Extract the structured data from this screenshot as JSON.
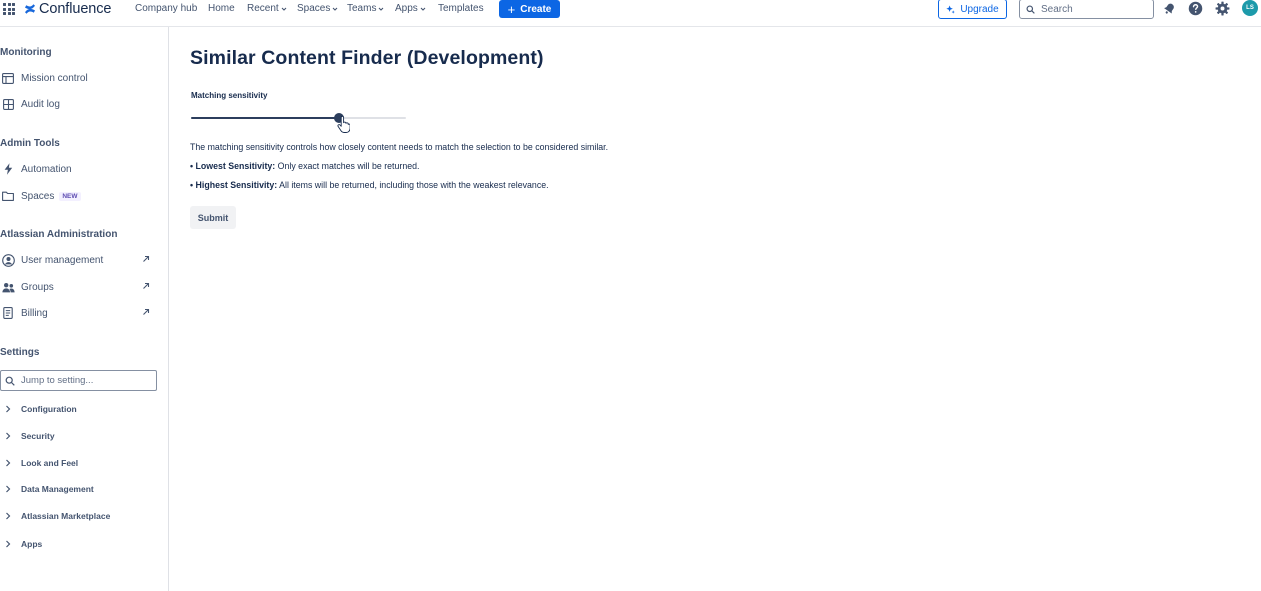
{
  "topbar": {
    "app_name": "Confluence",
    "nav": [
      {
        "label": "Company hub",
        "dropdown": false
      },
      {
        "label": "Home",
        "dropdown": false
      },
      {
        "label": "Recent",
        "dropdown": true
      },
      {
        "label": "Spaces",
        "dropdown": true
      },
      {
        "label": "Teams",
        "dropdown": true
      },
      {
        "label": "Apps",
        "dropdown": true
      },
      {
        "label": "Templates",
        "dropdown": false
      }
    ],
    "create_label": "Create",
    "upgrade_label": "Upgrade",
    "search_placeholder": "Search",
    "avatar_initials": "LS",
    "icons": [
      "app-switcher-icon",
      "confluence-logo-icon",
      "notifications-icon",
      "help-icon",
      "settings-icon"
    ]
  },
  "sidebar": {
    "sections": [
      {
        "heading": "Monitoring",
        "items": [
          {
            "label": "Mission control",
            "icon": "dashboard-icon"
          },
          {
            "label": "Audit log",
            "icon": "table-icon"
          }
        ]
      },
      {
        "heading": "Admin Tools",
        "items": [
          {
            "label": "Automation",
            "icon": "lightning-icon"
          },
          {
            "label": "Spaces",
            "icon": "folder-icon",
            "badge": "NEW"
          }
        ]
      },
      {
        "heading": "Atlassian Administration",
        "items": [
          {
            "label": "User management",
            "icon": "user-avatar-icon",
            "external": true
          },
          {
            "label": "Groups",
            "icon": "people-group-icon",
            "external": true
          },
          {
            "label": "Billing",
            "icon": "receipt-icon",
            "external": true
          }
        ]
      }
    ],
    "settings": {
      "heading": "Settings",
      "jump_placeholder": "Jump to setting...",
      "items": [
        "Configuration",
        "Security",
        "Look and Feel",
        "Data Management",
        "Atlassian Marketplace",
        "Apps"
      ]
    }
  },
  "main": {
    "title": "Similar Content Finder (Development)",
    "field_label": "Matching sensitivity",
    "slider_value_fraction": 0.69,
    "description": "The matching sensitivity controls how closely content needs to match the selection to be considered similar.",
    "bullets": [
      {
        "term": "• Lowest Sensitivity:",
        "text": " Only exact matches will be returned."
      },
      {
        "term": "• Highest Sensitivity:",
        "text": " All items will be returned, including those with the weakest relevance."
      }
    ],
    "submit_label": "Submit"
  },
  "colors": {
    "brand_blue": "#0c66e4",
    "text_primary": "#172b4d",
    "text_subtle": "#44546f",
    "slider_fill": "#2c3e5d",
    "avatar_bg": "#1d9aaa"
  }
}
